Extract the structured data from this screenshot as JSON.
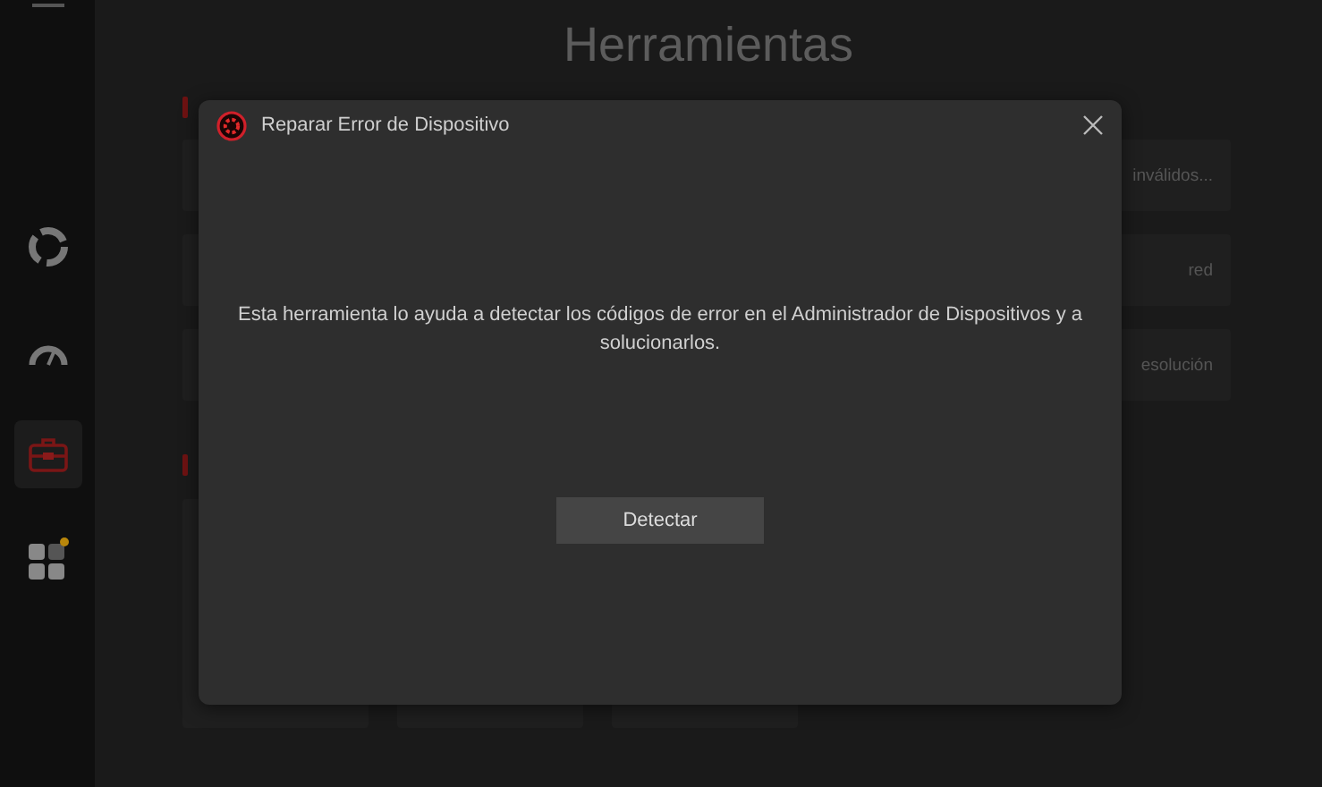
{
  "sidebar": {
    "items": [
      {
        "kind": "menu",
        "selected": false
      },
      {
        "kind": "ring",
        "selected": false
      },
      {
        "kind": "gauge",
        "selected": false
      },
      {
        "kind": "toolbox",
        "selected": true
      },
      {
        "kind": "apps",
        "selected": false
      }
    ]
  },
  "page_title": "Herramientas",
  "tool_cards": [
    {
      "text": "inválidos..."
    },
    {
      "text": "red"
    },
    {
      "text": "esolución"
    }
  ],
  "dialog": {
    "title": "Reparar Error de Dispositivo",
    "message": "Esta herramienta lo ayuda a detectar los códigos de error en el Administrador de Dispositivos y a solucionarlos.",
    "button": "Detectar"
  }
}
